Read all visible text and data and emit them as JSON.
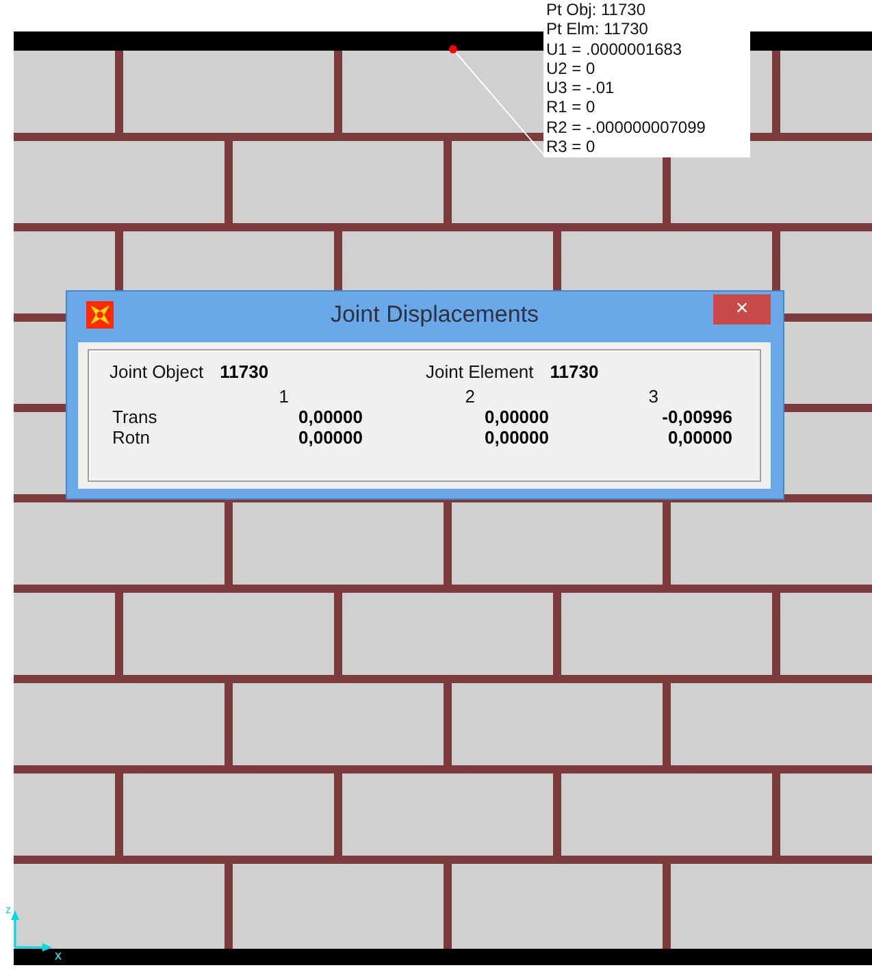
{
  "tooltip": {
    "lines": [
      "Pt Obj: 11730",
      "Pt Elm: 11730",
      "U1 =  .0000001683",
      "U2 =  0",
      "U3 = -.01",
      "R1 =  0",
      "R2 = -.000000007099",
      "R3 =  0"
    ]
  },
  "dialog": {
    "title": "Joint Displacements",
    "close": "×",
    "fields": [
      {
        "label": "Joint  Object",
        "value": "11730"
      },
      {
        "label": "Joint Element",
        "value": "11730"
      }
    ],
    "columns": [
      "1",
      "2",
      "3"
    ],
    "rows": [
      {
        "label": "Trans",
        "values": [
          "0,00000",
          "0,00000",
          "-0,00996"
        ]
      },
      {
        "label": "Rotn",
        "values": [
          "0,00000",
          "0,00000",
          "0,00000"
        ]
      }
    ]
  },
  "axes": {
    "vertical": "z",
    "horizontal": "x"
  }
}
